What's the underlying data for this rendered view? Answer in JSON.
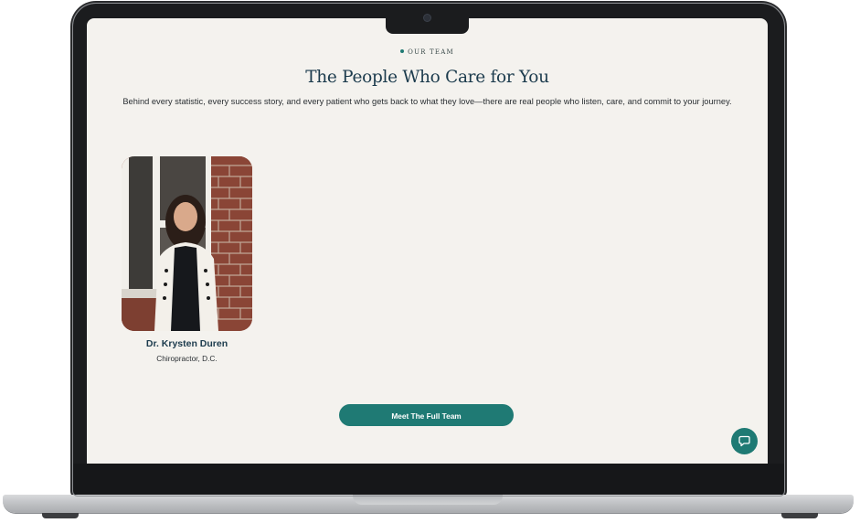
{
  "section": {
    "eyebrow": "OUR TEAM",
    "headline": "The People Who Care for You",
    "subtext": "Behind every statistic, every success story, and every patient who gets back to what they love—there are real people who listen, care, and commit to your journey."
  },
  "team": [
    {
      "name": "Dr. Krysten Duren",
      "role": "Chiropractor, D.C."
    }
  ],
  "cta": {
    "label": "Meet The Full Team"
  },
  "chat": {
    "icon": "chat-bubble-icon"
  },
  "colors": {
    "accent": "#1f7a74",
    "heading": "#1c3b4d",
    "background": "#f4f2ee"
  }
}
